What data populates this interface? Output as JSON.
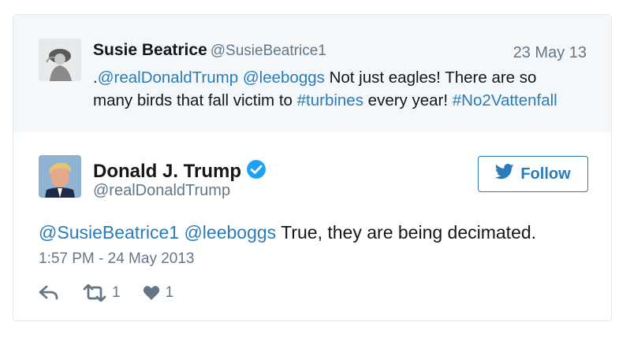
{
  "quoted_tweet": {
    "name": "Susie Beatrice",
    "handle": "@SusieBeatrice1",
    "date": "23 May 13",
    "text_parts": {
      "prefix": ".",
      "mention1": "@realDonaldTrump",
      "mention2": "@leeboggs",
      "text1": "Not just eagles! There are so many birds that fall victim to",
      "hashtag1": "#turbines",
      "text2": "every year!",
      "hashtag2": "#No2Vattenfall"
    }
  },
  "tweet": {
    "name": "Donald J. Trump",
    "handle": "@realDonaldTrump",
    "follow_label": "Follow",
    "text_parts": {
      "mention1": "@SusieBeatrice1",
      "mention2": "@leeboggs",
      "text": "True, they are being decimated."
    },
    "timestamp": "1:57 PM - 24 May 2013",
    "retweet_count": "1",
    "like_count": "1"
  },
  "icons": {
    "verified": "verified-badge-icon",
    "bird": "twitter-bird-icon",
    "reply": "reply-icon",
    "retweet": "retweet-icon",
    "like": "heart-icon"
  },
  "colors": {
    "link": "#2b7bb9",
    "muted": "#657786",
    "quoted_background": "#f5f8fa",
    "border": "#e1e8ed",
    "verified": "#1da1f2"
  }
}
